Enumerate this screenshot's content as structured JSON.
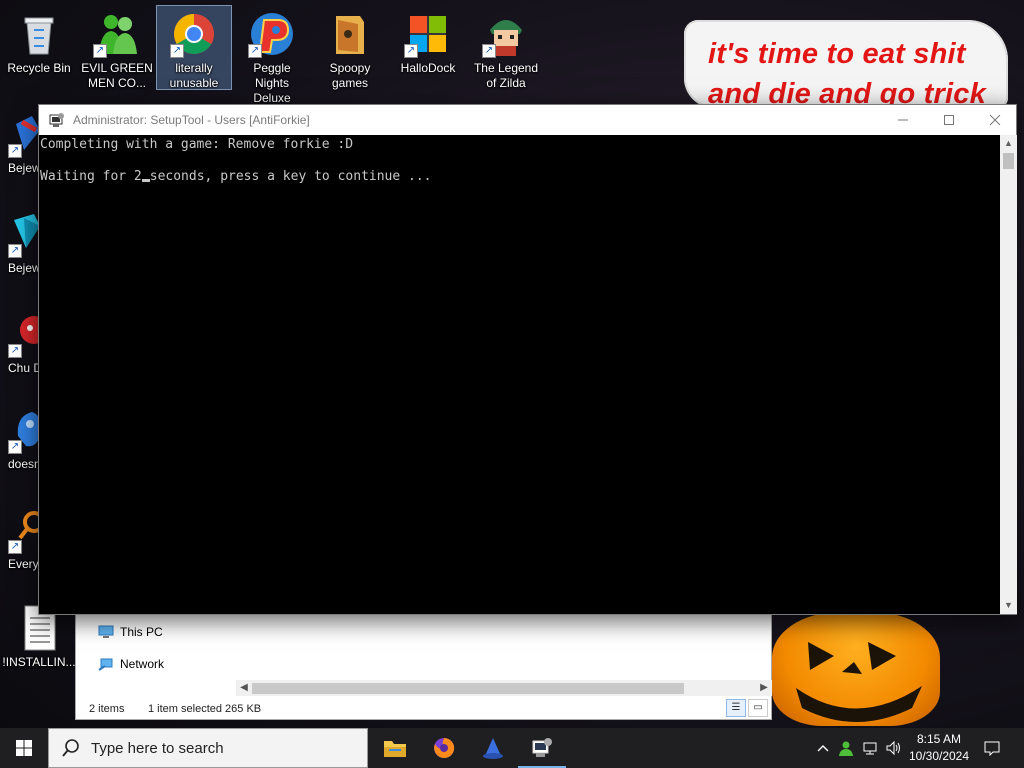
{
  "desktop": {
    "icons_top": [
      {
        "id": "recycle",
        "label": "Recycle Bin"
      },
      {
        "id": "evil",
        "label": "EVIL GREEN MEN CO..."
      },
      {
        "id": "chrome",
        "label": "literally unusable"
      },
      {
        "id": "peggle",
        "label": "Peggle Nights Deluxe"
      },
      {
        "id": "spoopy",
        "label": "Spoopy games"
      },
      {
        "id": "hallodock",
        "label": "HalloDock"
      },
      {
        "id": "zilda",
        "label": "The Legend of Zilda"
      }
    ],
    "icons_left": [
      {
        "id": "bejew1",
        "label": "Bejew Del"
      },
      {
        "id": "bejew2",
        "label": "Bejew Del"
      },
      {
        "id": "chu",
        "label": "Chu Del"
      },
      {
        "id": "doesn",
        "label": "doesn"
      },
      {
        "id": "every",
        "label": "Every"
      },
      {
        "id": "installing",
        "label": "!INSTALLIN..."
      }
    ],
    "banner_line1": "it's time to eat shit",
    "banner_line2": "and die and go trick"
  },
  "console": {
    "title": "Administrator:  SetupTool - Users [AntiForkie]",
    "line1": "Completing with a game: Remove forkie :D",
    "line2_prefix": "Waiting for 2",
    "line2_suffix": "seconds, press a key to continue ..."
  },
  "explorer": {
    "nav_items": [
      "This PC",
      "Network"
    ],
    "status_items": "2 items",
    "status_selected": "1 item selected  265 KB"
  },
  "taskbar": {
    "search_placeholder": "Type here to search",
    "time": "8:15 AM",
    "date": "10/30/2024"
  }
}
